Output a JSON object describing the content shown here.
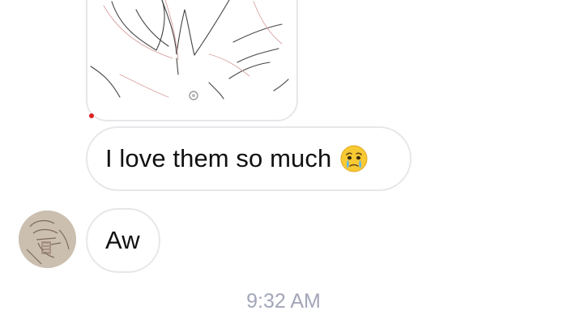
{
  "messages": [
    {
      "type": "image",
      "sender": "self",
      "content": "sketch-image"
    },
    {
      "type": "text",
      "sender": "self",
      "text": "I love them so much",
      "emoji": "crying-face-emoji"
    },
    {
      "type": "text",
      "sender": "other",
      "text": "Aw"
    }
  ],
  "timestamp": "9:32 AM",
  "colors": {
    "bubble_border": "#e7e7ea",
    "timestamp": "#a3a6b8",
    "status_dot": "#e02020"
  }
}
